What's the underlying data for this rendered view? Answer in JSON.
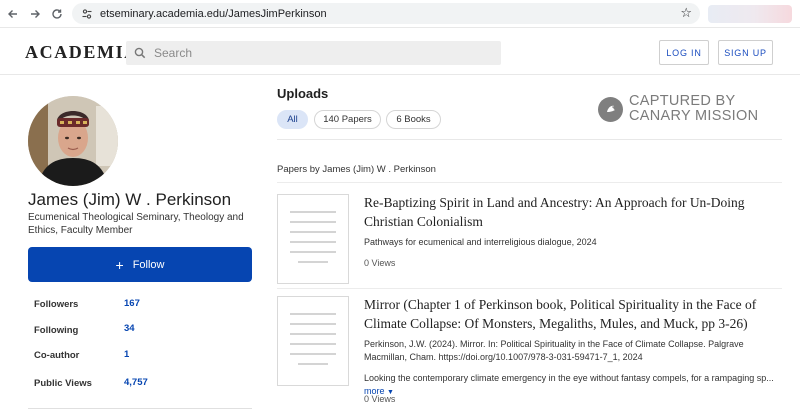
{
  "browser": {
    "url": "etseminary.academia.edu/JamesJimPerkinson"
  },
  "header": {
    "logo": "ACADEMIA",
    "search_placeholder": "Search",
    "login_label": "LOG IN",
    "signup_label": "SIGN UP"
  },
  "profile": {
    "name": "James (Jim) W . Perkinson",
    "affiliation": "Ecumenical Theological Seminary, Theology and Ethics, Faculty Member",
    "follow_label": "Follow",
    "stats": [
      {
        "label": "Followers",
        "value": "167"
      },
      {
        "label": "Following",
        "value": "34"
      },
      {
        "label": "Co-author",
        "value": "1"
      },
      {
        "label": "Public Views",
        "value": "4,757"
      }
    ]
  },
  "uploads": {
    "title": "Uploads",
    "filters": [
      {
        "label": "All",
        "active": true
      },
      {
        "label": "140 Papers",
        "active": false
      },
      {
        "label": "6 Books",
        "active": false
      }
    ],
    "watermark_line1": "CAPTURED BY",
    "watermark_line2": "CANARY MISSION",
    "section_heading": "Papers by James (Jim) W . Perkinson",
    "papers": [
      {
        "title": "Re-Baptizing Spirit in Land and Ancestry: An Approach for Un-Doing Christian Colonialism",
        "meta": "Pathways for ecumenical and interreligious dialogue, 2024",
        "views": "0 Views"
      },
      {
        "title": "Mirror (Chapter 1 of Perkinson book, Political Spirituality in the Face of Climate Collapse: Of Monsters, Megaliths, Mules, and Muck, pp 3-26)",
        "meta": "Perkinson, J.W. (2024). Mirror. In: Political Spirituality in the Face of Climate Collapse. Palgrave Macmillan, Cham. https://doi.org/10.1007/978-3-031-59471-7_1, 2024",
        "snippet": "Looking the contemporary climate emergency in the eye without fantasy compels, for a rampaging sp...",
        "more_label": "more",
        "views": "0 Views"
      }
    ]
  },
  "colors": {
    "brand_blue": "#0645b1",
    "pill_active_bg": "#dbe5f7"
  }
}
